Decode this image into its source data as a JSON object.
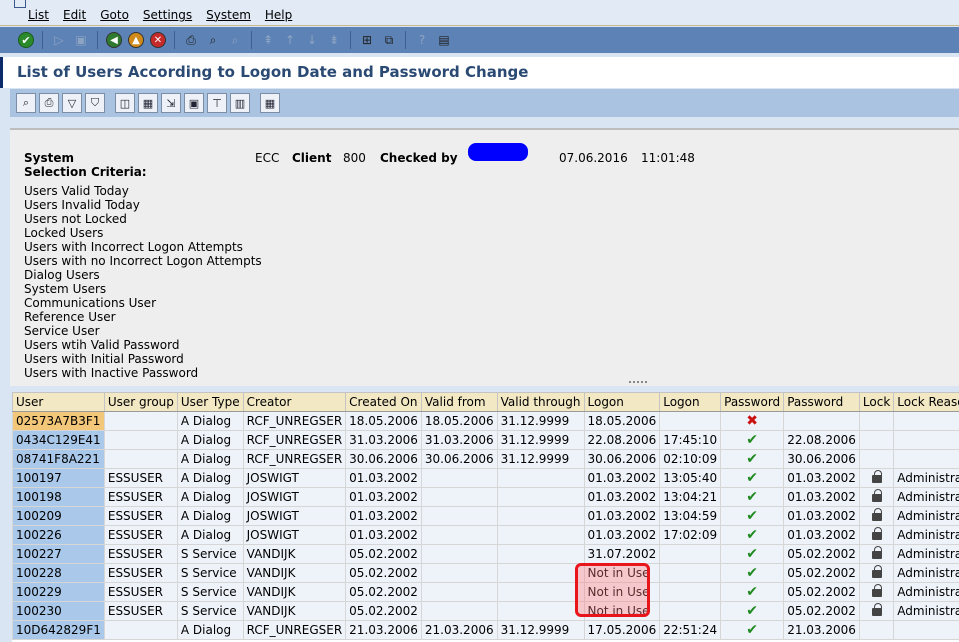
{
  "menu": [
    "List",
    "Edit",
    "Goto",
    "Settings",
    "System",
    "Help"
  ],
  "title": "List of Users According to Logon Date and Password Change",
  "header": {
    "system_label": "System",
    "system_value": "ECC",
    "client_label": "Client",
    "client_value": "800",
    "checked_by_label": "Checked by",
    "date": "07.06.2016",
    "time": "11:01:48",
    "selection_label": "Selection Criteria:",
    "criteria": [
      "Users Valid Today",
      "Users Invalid Today",
      "Users not Locked",
      "Locked Users",
      "Users with Incorrect Logon Attempts",
      "Users with no Incorrect Logon Attempts",
      "Dialog Users",
      "System Users",
      "Communications User",
      "Reference User",
      "Service User",
      "Users wtih Valid Password",
      "Users with Initial Password",
      "Users with Inactive Password"
    ]
  },
  "table": {
    "columns": [
      "User",
      "User group",
      "User Type",
      "Creator",
      "Created On",
      "Valid from",
      "Valid through",
      "Logon",
      "Logon",
      "Password",
      "Password",
      "Lock",
      "Lock Reason"
    ],
    "rows": [
      {
        "user": "02573A7B3F1",
        "group": "",
        "type": "A Dialog",
        "creator": "RCF_UNREGSER",
        "created": "18.05.2006",
        "valid_from": "18.05.2006",
        "valid_through": "31.12.9999",
        "logon_date": "18.05.2006",
        "logon_time": "",
        "pw_status": "x",
        "pw_date": "",
        "locked": false,
        "lock_reason": ""
      },
      {
        "user": "0434C129E41",
        "group": "",
        "type": "A Dialog",
        "creator": "RCF_UNREGSER",
        "created": "31.03.2006",
        "valid_from": "31.03.2006",
        "valid_through": "31.12.9999",
        "logon_date": "22.08.2006",
        "logon_time": "17:45:10",
        "pw_status": "ok",
        "pw_date": "22.08.2006",
        "locked": false,
        "lock_reason": ""
      },
      {
        "user": "08741F8A221",
        "group": "",
        "type": "A Dialog",
        "creator": "RCF_UNREGSER",
        "created": "30.06.2006",
        "valid_from": "30.06.2006",
        "valid_through": "31.12.9999",
        "logon_date": "30.06.2006",
        "logon_time": "02:10:09",
        "pw_status": "ok",
        "pw_date": "30.06.2006",
        "locked": false,
        "lock_reason": ""
      },
      {
        "user": "100197",
        "group": "ESSUSER",
        "type": "A Dialog",
        "creator": "JOSWIGT",
        "created": "01.03.2002",
        "valid_from": "",
        "valid_through": "",
        "logon_date": "01.03.2002",
        "logon_time": "13:05:40",
        "pw_status": "ok",
        "pw_date": "01.03.2002",
        "locked": true,
        "lock_reason": "Administrator"
      },
      {
        "user": "100198",
        "group": "ESSUSER",
        "type": "A Dialog",
        "creator": "JOSWIGT",
        "created": "01.03.2002",
        "valid_from": "",
        "valid_through": "",
        "logon_date": "01.03.2002",
        "logon_time": "13:04:21",
        "pw_status": "ok",
        "pw_date": "01.03.2002",
        "locked": true,
        "lock_reason": "Administrator"
      },
      {
        "user": "100209",
        "group": "ESSUSER",
        "type": "A Dialog",
        "creator": "JOSWIGT",
        "created": "01.03.2002",
        "valid_from": "",
        "valid_through": "",
        "logon_date": "01.03.2002",
        "logon_time": "13:04:59",
        "pw_status": "ok",
        "pw_date": "01.03.2002",
        "locked": true,
        "lock_reason": "Administrator"
      },
      {
        "user": "100226",
        "group": "ESSUSER",
        "type": "A Dialog",
        "creator": "JOSWIGT",
        "created": "01.03.2002",
        "valid_from": "",
        "valid_through": "",
        "logon_date": "01.03.2002",
        "logon_time": "17:02:09",
        "pw_status": "ok",
        "pw_date": "01.03.2002",
        "locked": true,
        "lock_reason": "Administrator"
      },
      {
        "user": "100227",
        "group": "ESSUSER",
        "type": "S Service",
        "creator": "VANDIJK",
        "created": "05.02.2002",
        "valid_from": "",
        "valid_through": "",
        "logon_date": "31.07.2002",
        "logon_time": "",
        "pw_status": "ok",
        "pw_date": "05.02.2002",
        "locked": true,
        "lock_reason": "Administrator"
      },
      {
        "user": "100228",
        "group": "ESSUSER",
        "type": "S Service",
        "creator": "VANDIJK",
        "created": "05.02.2002",
        "valid_from": "",
        "valid_through": "",
        "logon_date": "Not in Use",
        "logon_time": "",
        "pw_status": "ok",
        "pw_date": "05.02.2002",
        "locked": true,
        "lock_reason": "Administrator"
      },
      {
        "user": "100229",
        "group": "ESSUSER",
        "type": "S Service",
        "creator": "VANDIJK",
        "created": "05.02.2002",
        "valid_from": "",
        "valid_through": "",
        "logon_date": "Not in Use",
        "logon_time": "",
        "pw_status": "ok",
        "pw_date": "05.02.2002",
        "locked": true,
        "lock_reason": "Administrator"
      },
      {
        "user": "100230",
        "group": "ESSUSER",
        "type": "S Service",
        "creator": "VANDIJK",
        "created": "05.02.2002",
        "valid_from": "",
        "valid_through": "",
        "logon_date": "Not in Use",
        "logon_time": "",
        "pw_status": "ok",
        "pw_date": "05.02.2002",
        "locked": true,
        "lock_reason": "Administrator"
      },
      {
        "user": "10D642829F1",
        "group": "",
        "type": "A Dialog",
        "creator": "RCF_UNREGSER",
        "created": "21.03.2006",
        "valid_from": "21.03.2006",
        "valid_through": "31.12.9999",
        "logon_date": "17.05.2006",
        "logon_time": "22:51:24",
        "pw_status": "ok",
        "pw_date": "21.03.2006",
        "locked": false,
        "lock_reason": ""
      }
    ]
  },
  "colors": {
    "accent_title": "#2a4a74",
    "toolbar": "#5d82b5",
    "highlight": "#e8161b",
    "check": "#1e8a1e",
    "cross": "#cc1111"
  }
}
